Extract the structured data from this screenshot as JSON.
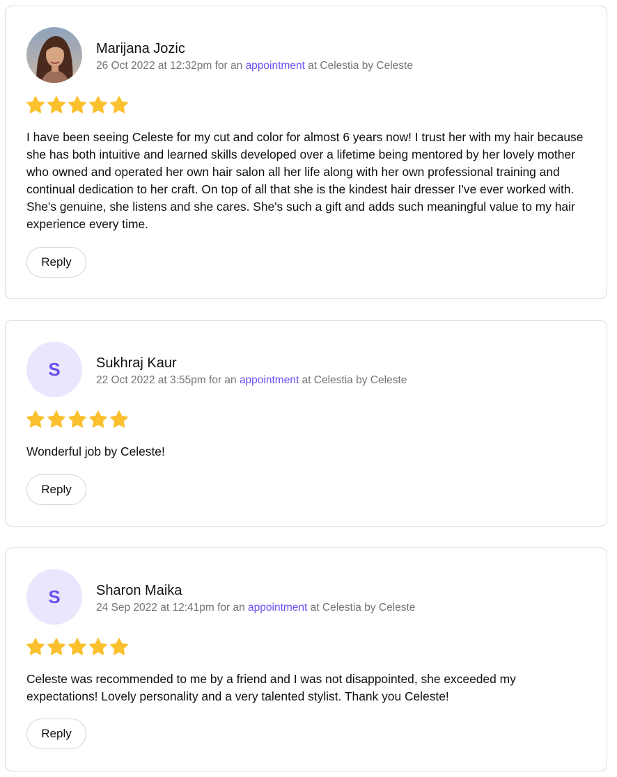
{
  "reviews": [
    {
      "name": "Marijana Jozic",
      "avatar_initial": "",
      "date": "26 Oct 2022 at 12:32pm",
      "for_text": " for an ",
      "link_text": "appointment",
      "venue_text": " at Celestia by Celeste",
      "rating": 5,
      "text": "I have been seeing Celeste for my cut and color for almost 6 years now! I trust her with my hair because she has both intuitive and learned skills developed over a lifetime being mentored by her lovely mother who owned and operated her own hair salon all her life along with her own professional training and continual dedication to her craft. On top of all that she is the kindest hair dresser I've ever worked with. She's genuine, she listens and she cares. She's such a gift and adds such meaningful value to my  hair experience every time.",
      "reply_label": "Reply"
    },
    {
      "name": "Sukhraj Kaur",
      "avatar_initial": "S",
      "date": "22 Oct 2022 at 3:55pm",
      "for_text": " for an ",
      "link_text": "appointment",
      "venue_text": " at Celestia by Celeste",
      "rating": 5,
      "text": "Wonderful job by Celeste!",
      "reply_label": "Reply"
    },
    {
      "name": "Sharon Maika",
      "avatar_initial": "S",
      "date": "24 Sep 2022 at 12:41pm",
      "for_text": " for an ",
      "link_text": "appointment",
      "venue_text": " at Celestia by Celeste",
      "rating": 5,
      "text": "Celeste was recommended to me by a friend and I was not disappointed, she exceeded my expectations! Lovely personality and a very talented stylist. Thank you Celeste!",
      "reply_label": "Reply"
    }
  ],
  "colors": {
    "star": "#fbc02d",
    "link": "#6950f3",
    "avatar_bg": "#e9e7fd",
    "meta": "#737373",
    "border": "#dcdcdf"
  },
  "icons": {
    "rating": "star-icon"
  }
}
